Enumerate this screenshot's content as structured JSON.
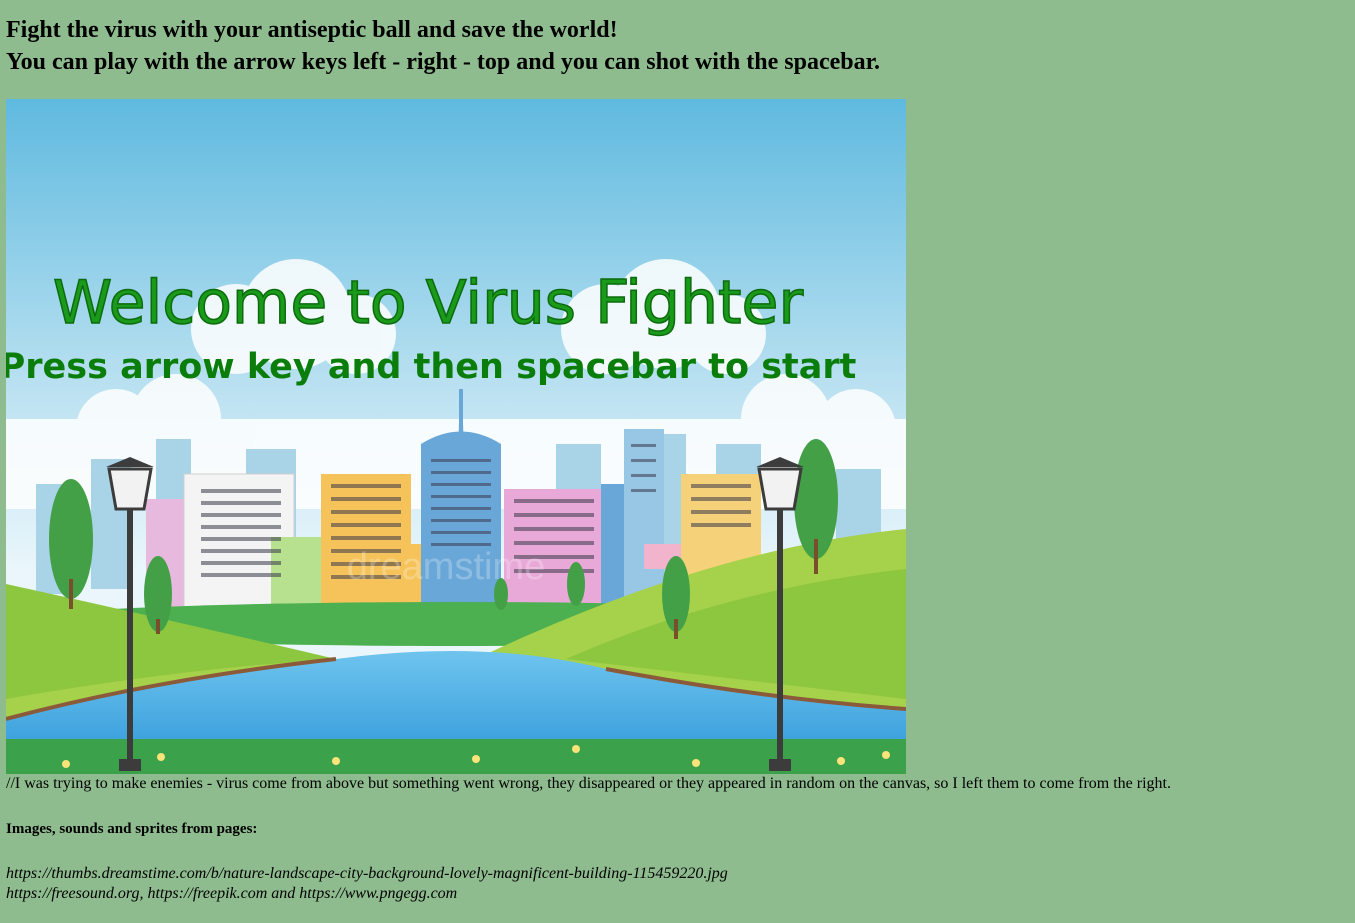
{
  "header": {
    "line1": "Fight the virus with your antiseptic ball and save the world!",
    "line2": "You can play with the arrow keys left - right - top and you can shot with the spacebar."
  },
  "canvas": {
    "title": "Welcome to Virus Fighter",
    "subtitle": "Press arrow key and then spacebar to start",
    "watermark": "dreamstime"
  },
  "note": "//I was trying to make enemies - virus come from above but something went wrong, they disappeared or they appeared in random on the canvas, so I left them to come from the right.",
  "credits": {
    "heading": "Images, sounds and sprites from pages:",
    "line1": "https://thumbs.dreamstime.com/b/nature-landscape-city-background-lovely-magnificent-building-115459220.jpg",
    "line2": "https://freesound.org, https://freepik.com and https://www.pngegg.com"
  },
  "colors": {
    "page_background": "#8fbc8f",
    "title_green": "#1a9a1a",
    "subtitle_green": "#0a7d0a"
  }
}
